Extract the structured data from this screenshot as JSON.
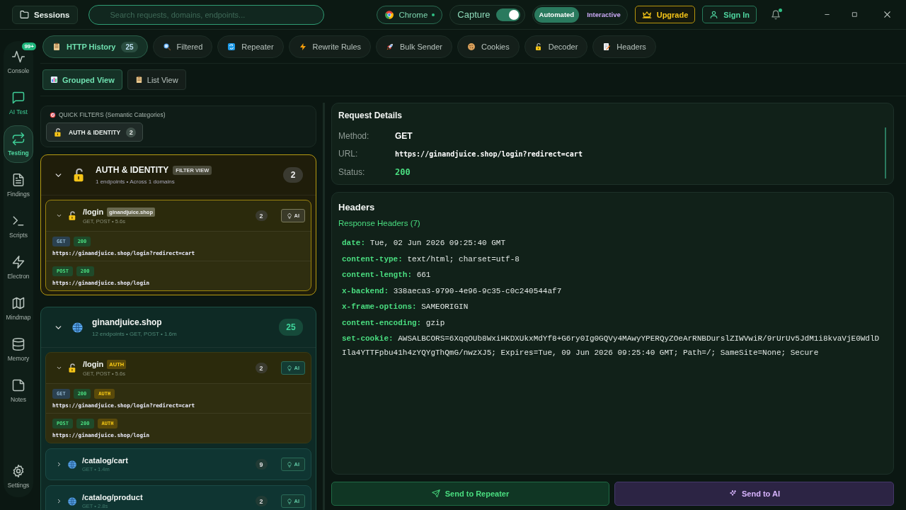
{
  "sessions_button": "Sessions",
  "search": {
    "placeholder": "Search requests, domains, endpoints..."
  },
  "browser": {
    "label": "Chrome",
    "connected": true
  },
  "capture": {
    "label": "Capture",
    "on": true
  },
  "modes": [
    {
      "label": "Automated",
      "selected": true
    },
    {
      "label": "Interactive",
      "selected": false
    }
  ],
  "upgrade_button": "Upgrade",
  "sign_in_button": "Sign In",
  "notifications": {
    "unread": true
  },
  "sidebar": {
    "items": [
      {
        "label": "Console",
        "kind": "pulse",
        "badge": "99+",
        "selected": false
      },
      {
        "label": "AI Test",
        "kind": "chat",
        "selected": false
      },
      {
        "label": "Testing",
        "kind": "swap",
        "selected": true
      },
      {
        "label": "Findings",
        "kind": "file",
        "selected": false
      },
      {
        "label": "Scripts",
        "kind": "terminal",
        "selected": false
      },
      {
        "label": "Electron",
        "kind": "bolt",
        "selected": false
      },
      {
        "label": "Mindmap",
        "kind": "map",
        "selected": false
      },
      {
        "label": "Memory",
        "kind": "database",
        "selected": false
      },
      {
        "label": "Notes",
        "kind": "note",
        "selected": false
      },
      {
        "label": "Settings",
        "kind": "gear",
        "selected": false
      }
    ]
  },
  "tabs": [
    {
      "label": "HTTP History",
      "kind": "clipboard",
      "count": "25",
      "selected": true
    },
    {
      "label": "Filtered",
      "kind": "magnifier",
      "selected": false
    },
    {
      "label": "Repeater",
      "kind": "repeat",
      "selected": false
    },
    {
      "label": "Rewrite Rules",
      "kind": "zap",
      "selected": false
    },
    {
      "label": "Bulk Sender",
      "kind": "rocket",
      "selected": false
    },
    {
      "label": "Cookies",
      "kind": "cookie",
      "selected": false
    },
    {
      "label": "Decoder",
      "kind": "padlock",
      "selected": false
    },
    {
      "label": "Headers",
      "kind": "memo",
      "selected": false
    }
  ],
  "views": [
    {
      "label": "Grouped View",
      "kind": "chart",
      "selected": true
    },
    {
      "label": "List View",
      "kind": "clipboard",
      "selected": false
    }
  ],
  "quick_filters": {
    "title": "QUICK FILTERS (Semantic Categories)",
    "chips": [
      {
        "label": "AUTH & IDENTITY",
        "count": "2"
      }
    ]
  },
  "groups": [
    {
      "kind": "category",
      "title": "AUTH & IDENTITY",
      "tag": "FILTER VIEW",
      "meta": "1 endpoints • Across 1 domains",
      "count": "2",
      "expanded": true,
      "endpoints": [
        {
          "kind": "auth",
          "path": "/login",
          "tag": {
            "label": "ginandjuice.shop",
            "kind": "domain"
          },
          "meta": "GET, POST • 5.6s",
          "count": "2",
          "ai_button": "AI",
          "expanded": true,
          "requests": [
            {
              "badges": [
                {
                  "label": "GET",
                  "kind": "get"
                },
                {
                  "label": "200",
                  "kind": "status"
                }
              ],
              "url": "https://ginandjuice.shop/login?redirect=cart"
            },
            {
              "badges": [
                {
                  "label": "POST",
                  "kind": "post"
                },
                {
                  "label": "200",
                  "kind": "status"
                }
              ],
              "url": "https://ginandjuice.shop/login"
            }
          ]
        }
      ]
    },
    {
      "kind": "domain",
      "title": "ginandjuice.shop",
      "meta": "12 endpoints • GET, POST • 1.6m",
      "count": "25",
      "expanded": true,
      "endpoints": [
        {
          "kind": "auth",
          "path": "/login",
          "tag": {
            "label": "AUTH",
            "kind": "auth"
          },
          "meta": "GET, POST • 5.6s",
          "count": "2",
          "ai_button": "AI",
          "expanded": true,
          "requests": [
            {
              "badges": [
                {
                  "label": "GET",
                  "kind": "get"
                },
                {
                  "label": "200",
                  "kind": "status"
                },
                {
                  "label": "AUTH",
                  "kind": "auth"
                }
              ],
              "url": "https://ginandjuice.shop/login?redirect=cart"
            },
            {
              "badges": [
                {
                  "label": "POST",
                  "kind": "post"
                },
                {
                  "label": "200",
                  "kind": "status"
                },
                {
                  "label": "AUTH",
                  "kind": "auth"
                }
              ],
              "url": "https://ginandjuice.shop/login"
            }
          ]
        },
        {
          "kind": "plain",
          "path": "/catalog/cart",
          "meta": "GET • 1.4m",
          "count": "9",
          "ai_button": "AI",
          "expanded": false
        },
        {
          "kind": "plain",
          "path": "/catalog/product",
          "meta": "GET • 2.8s",
          "count": "2",
          "ai_button": "AI",
          "expanded": false
        }
      ]
    }
  ],
  "details": {
    "title": "Request Details",
    "fields": [
      {
        "label": "Method:",
        "value": "GET",
        "kind": "method"
      },
      {
        "label": "URL:",
        "value": "https://ginandjuice.shop/login?redirect=cart",
        "kind": "url"
      },
      {
        "label": "Status:",
        "value": "200",
        "kind": "status"
      }
    ]
  },
  "headers": {
    "title": "Headers",
    "subtitle": "Response Headers (7)",
    "items": [
      {
        "name": "date:",
        "value": "Tue, 02 Jun 2026 09:25:40 GMT"
      },
      {
        "name": "content-type:",
        "value": "text/html; charset=utf-8"
      },
      {
        "name": "content-length:",
        "value": "661"
      },
      {
        "name": "x-backend:",
        "value": "338aeca3-9790-4e96-9c35-c0c240544af7"
      },
      {
        "name": "x-frame-options:",
        "value": "SAMEORIGIN"
      },
      {
        "name": "content-encoding:",
        "value": "gzip"
      },
      {
        "name": "set-cookie:",
        "value": "AWSALBCORS=6XqqOUb8WxiHKDXUkxMdYf8+G6ry0Ig0GQVy4MAwyYPERQyZOeArRNBDurslZIWVwiR/9rUrUv5JdM1i8kvaVjE0WdlDIla4YTTFpbu41h4zYQYgThQmG/nwzXJ5; Expires=Tue, 09 Jun 2026 09:25:40 GMT; Path=/; SameSite=None; Secure"
      }
    ]
  },
  "actions": [
    {
      "label": "Send to Repeater",
      "kind": "repeater"
    },
    {
      "label": "Send to AI",
      "kind": "ai"
    }
  ]
}
